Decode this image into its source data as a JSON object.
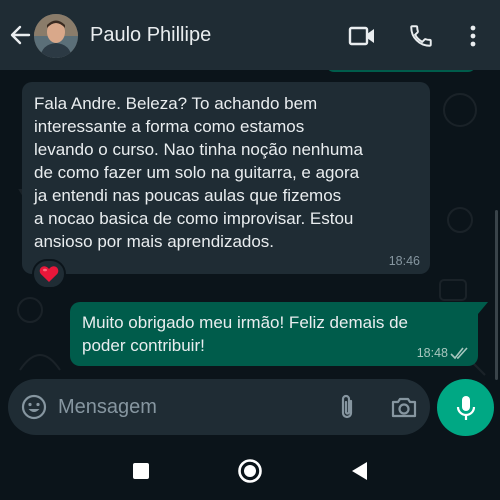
{
  "header": {
    "contact_name": "Paulo Phillipe",
    "icons": [
      "back-arrow-icon",
      "video-call-icon",
      "phone-icon",
      "more-options-icon"
    ]
  },
  "messages": [
    {
      "direction": "incoming",
      "text": "Fala Andre. Beleza? To achando bem\ninteressante a forma como estamos\nlevando o curso. Nao tinha noção nenhuma\nde como fazer um solo na guitarra, e agora\nja entendi nas poucas aulas que fizemos\na nocao basica de como improvisar. Estou\nansioso por mais aprendizados.",
      "time": "18:46",
      "reaction": "❤️"
    },
    {
      "direction": "outgoing",
      "text": "Muito obrigado meu irmão! Feliz demais de\npoder contribuir!",
      "time": "18:48",
      "status": "read"
    }
  ],
  "composer": {
    "placeholder": "Mensagem",
    "value": ""
  },
  "colors": {
    "background": "#0b141a",
    "header": "#1f2c34",
    "incoming_bubble": "#1f2c34",
    "outgoing_bubble": "#005c4b",
    "accent": "#00a884",
    "reaction": "#e8173a"
  },
  "navbar": {
    "icons": [
      "recents-square-icon",
      "home-circle-icon",
      "back-triangle-icon"
    ]
  }
}
